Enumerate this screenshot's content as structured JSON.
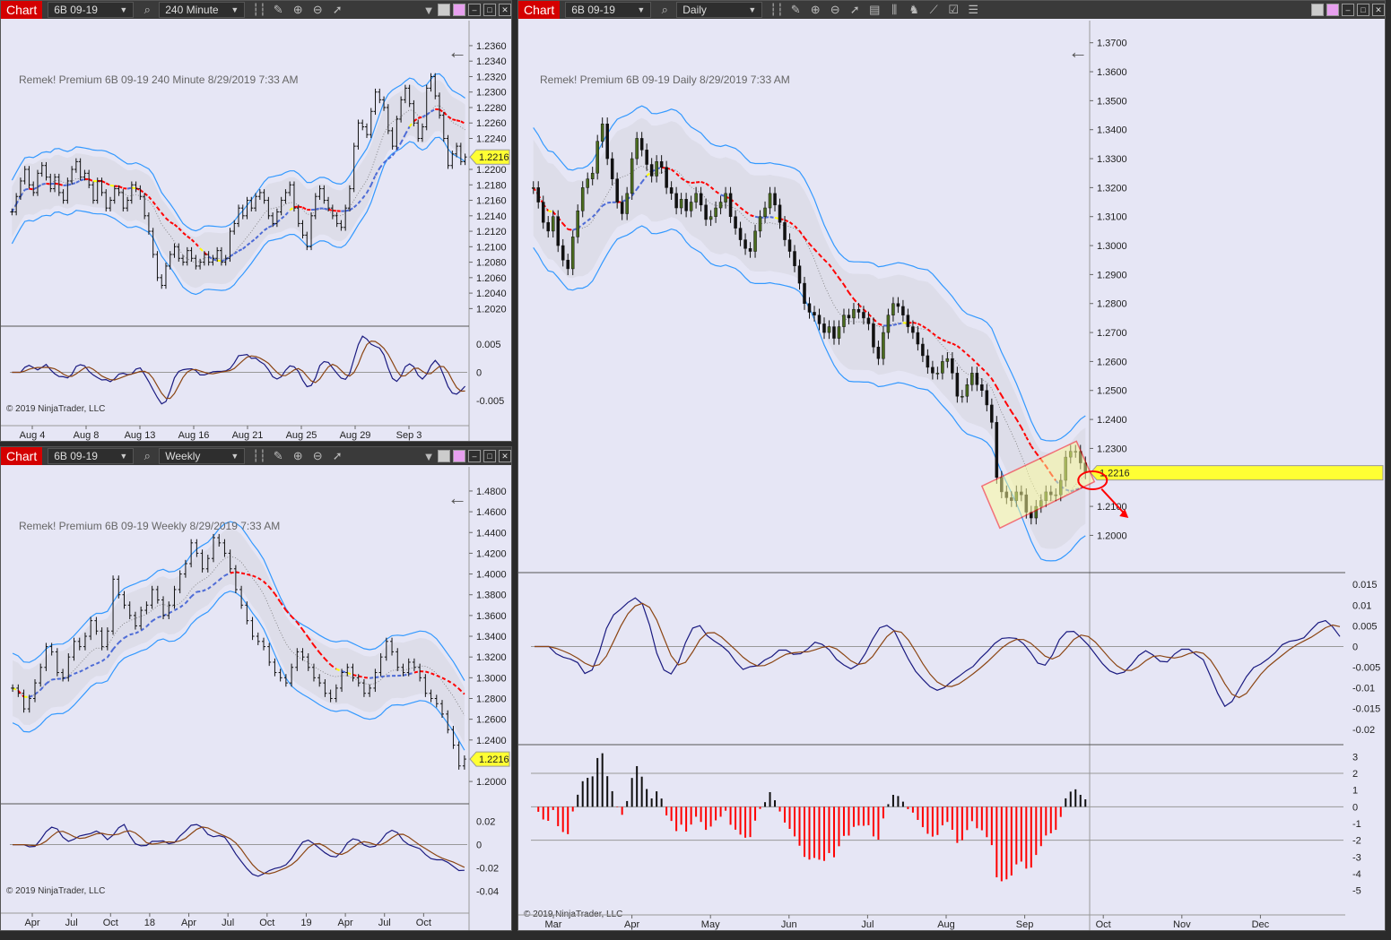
{
  "colors": {
    "panel_bg": "#e6e6f5",
    "band": "#d9d9e4",
    "bull": "#4a6b1e",
    "red": "#ff0000",
    "yellow": "#ffff00",
    "blue": "#4d6bd6",
    "channel": "#3399ff",
    "cyan": "#33bbff",
    "osc1": "#1a1a80",
    "osc2": "#8b4513",
    "price_tag": "#ffff33"
  },
  "windows": {
    "w240": {
      "title": "Chart",
      "instrument": "6B 09-19",
      "interval": "240 Minute",
      "watermark": "Remek!  Premium  6B 09-19  240 Minute  8/29/2019 7:33 AM",
      "copyright": "© 2019 NinjaTrader, LLC",
      "price_tag": "1.2216",
      "back_arrow": "←"
    },
    "daily": {
      "title": "Chart",
      "instrument": "6B 09-19",
      "interval": "Daily",
      "watermark": "Remek!  Premium  6B 09-19  Daily  8/29/2019 7:33 AM",
      "copyright": "© 2019 NinjaTrader, LLC",
      "price_tag": "1.2216",
      "back_arrow": "←"
    },
    "weekly": {
      "title": "Chart",
      "instrument": "6B 09-19",
      "interval": "Weekly",
      "watermark": "Remek!  Premium  6B 09-19  Weekly  8/29/2019 7:33 AM",
      "copyright": "© 2019 NinjaTrader, LLC",
      "price_tag": "1.2216",
      "back_arrow": "←"
    }
  },
  "chart_data": [
    {
      "type": "candlestick",
      "instrument": "6B 09-19",
      "interval": "240 Minute",
      "x_tick_labels": [
        "Aug 4",
        "Aug 8",
        "Aug 13",
        "Aug 16",
        "Aug 21",
        "Aug 25",
        "Aug 29",
        "Sep 3"
      ],
      "y_tick_labels": [
        "1.2360",
        "1.2340",
        "1.2320",
        "1.2300",
        "1.2280",
        "1.2260",
        "1.2240",
        "1.2200",
        "1.2180",
        "1.2160",
        "1.2140",
        "1.2120",
        "1.2100",
        "1.2080",
        "1.2060",
        "1.2040",
        "1.2020"
      ],
      "ylim": [
        1.201,
        1.2375
      ],
      "close": [
        1.2145,
        1.2165,
        1.2185,
        1.22,
        1.218,
        1.217,
        1.2195,
        1.2205,
        1.219,
        1.2175,
        1.219,
        1.217,
        1.216,
        1.2185,
        1.22,
        1.221,
        1.219,
        1.2195,
        1.218,
        1.216,
        1.2185,
        1.217,
        1.215,
        1.216,
        1.2175,
        1.217,
        1.215,
        1.216,
        1.218,
        1.2175,
        1.2165,
        1.214,
        1.212,
        1.209,
        1.206,
        1.205,
        1.2075,
        1.209,
        1.21,
        1.2085,
        1.208,
        1.2095,
        1.2085,
        1.2075,
        1.208,
        1.209,
        1.208,
        1.2085,
        1.2095,
        1.208,
        1.2085,
        1.212,
        1.213,
        1.215,
        1.214,
        1.216,
        1.215,
        1.2165,
        1.217,
        1.216,
        1.214,
        1.213,
        1.2145,
        1.216,
        1.217,
        1.218,
        1.215,
        1.213,
        1.2115,
        1.21,
        1.214,
        1.2165,
        1.2175,
        1.216,
        1.215,
        1.214,
        1.213,
        1.2125,
        1.215,
        1.2175,
        1.223,
        1.226,
        1.2255,
        1.2245,
        1.2275,
        1.23,
        1.229,
        1.228,
        1.225,
        1.223,
        1.2265,
        1.229,
        1.2305,
        1.2285,
        1.226,
        1.224,
        1.2255,
        1.2305,
        1.232,
        1.2295,
        1.227,
        1.224,
        1.2205,
        1.222,
        1.223,
        1.221,
        1.2216
      ],
      "oscillator": {
        "y_tick_labels": [
          "0.005",
          "0",
          "-0.005"
        ],
        "ylim": [
          -0.0075,
          0.0075
        ]
      }
    },
    {
      "type": "candlestick",
      "instrument": "6B 09-19",
      "interval": "Daily",
      "x_tick_labels": [
        "Mar",
        "Apr",
        "May",
        "Jun",
        "Jul",
        "Aug",
        "Sep",
        "Oct",
        "Nov",
        "Dec"
      ],
      "y_tick_labels": [
        "1.3700",
        "1.3600",
        "1.3500",
        "1.3400",
        "1.3300",
        "1.3200",
        "1.3100",
        "1.3000",
        "1.2900",
        "1.2800",
        "1.2700",
        "1.2600",
        "1.2500",
        "1.2400",
        "1.2300",
        "1.2100",
        "1.2000"
      ],
      "ylim": [
        1.189,
        1.373
      ],
      "close": [
        1.32,
        1.315,
        1.308,
        1.305,
        1.31,
        1.3,
        1.295,
        1.292,
        1.303,
        1.312,
        1.32,
        1.323,
        1.325,
        1.336,
        1.342,
        1.33,
        1.323,
        1.315,
        1.311,
        1.318,
        1.33,
        1.337,
        1.333,
        1.328,
        1.324,
        1.329,
        1.327,
        1.32,
        1.318,
        1.313,
        1.316,
        1.312,
        1.315,
        1.318,
        1.314,
        1.309,
        1.31,
        1.313,
        1.315,
        1.318,
        1.31,
        1.306,
        1.302,
        1.299,
        1.298,
        1.305,
        1.31,
        1.313,
        1.318,
        1.314,
        1.308,
        1.302,
        1.298,
        1.293,
        1.287,
        1.28,
        1.277,
        1.276,
        1.273,
        1.27,
        1.272,
        1.268,
        1.272,
        1.276,
        1.275,
        1.278,
        1.277,
        1.275,
        1.273,
        1.265,
        1.261,
        1.27,
        1.276,
        1.28,
        1.279,
        1.276,
        1.272,
        1.27,
        1.266,
        1.262,
        1.258,
        1.256,
        1.256,
        1.26,
        1.261,
        1.256,
        1.248,
        1.248,
        1.252,
        1.256,
        1.252,
        1.25,
        1.245,
        1.239,
        1.22,
        1.215,
        1.213,
        1.212,
        1.215,
        1.214,
        1.208,
        1.206,
        1.21,
        1.212,
        1.215,
        1.214,
        1.214,
        1.219,
        1.227,
        1.229,
        1.229,
        1.225,
        1.2216
      ],
      "channel": {
        "type": "rising wedge",
        "color": "#ff0000"
      },
      "oscillator": {
        "y_tick_labels": [
          "0.015",
          "0.01",
          "0.005",
          "0",
          "-0.005",
          "-0.01",
          "-0.015",
          "-0.02"
        ],
        "ylim": [
          -0.022,
          0.017
        ]
      },
      "histogram": {
        "y_tick_labels": [
          "3",
          "2",
          "1",
          "0",
          "-1",
          "-2",
          "-3",
          "-4",
          "-5"
        ],
        "ylim": [
          -5.5,
          3.5
        ]
      }
    },
    {
      "type": "candlestick",
      "instrument": "6B 09-19",
      "interval": "Weekly",
      "x_tick_labels": [
        "Apr",
        "Jul",
        "Oct",
        "18",
        "Apr",
        "Jul",
        "Oct",
        "19",
        "Apr",
        "Jul",
        "Oct"
      ],
      "y_tick_labels": [
        "1.4800",
        "1.4600",
        "1.4400",
        "1.4200",
        "1.4000",
        "1.3800",
        "1.3600",
        "1.3400",
        "1.3200",
        "1.3000",
        "1.2800",
        "1.2600",
        "1.2400",
        "1.2000"
      ],
      "ylim": [
        1.188,
        1.486
      ],
      "close": [
        1.29,
        1.285,
        1.27,
        1.28,
        1.295,
        1.31,
        1.33,
        1.325,
        1.305,
        1.3,
        1.32,
        1.335,
        1.33,
        1.34,
        1.355,
        1.345,
        1.33,
        1.345,
        1.395,
        1.38,
        1.37,
        1.36,
        1.35,
        1.365,
        1.37,
        1.385,
        1.375,
        1.36,
        1.37,
        1.385,
        1.4,
        1.41,
        1.43,
        1.42,
        1.405,
        1.415,
        1.435,
        1.43,
        1.42,
        1.405,
        1.385,
        1.37,
        1.355,
        1.34,
        1.335,
        1.33,
        1.315,
        1.305,
        1.3,
        1.295,
        1.31,
        1.325,
        1.32,
        1.31,
        1.3,
        1.295,
        1.285,
        1.28,
        1.29,
        1.305,
        1.31,
        1.3,
        1.295,
        1.285,
        1.29,
        1.305,
        1.32,
        1.335,
        1.325,
        1.31,
        1.305,
        1.315,
        1.31,
        1.3,
        1.285,
        1.28,
        1.275,
        1.265,
        1.25,
        1.235,
        1.215,
        1.2216
      ],
      "oscillator": {
        "y_tick_labels": [
          "0.02",
          "0",
          "-0.02",
          "-0.04"
        ],
        "ylim": [
          -0.045,
          0.032
        ]
      }
    }
  ]
}
